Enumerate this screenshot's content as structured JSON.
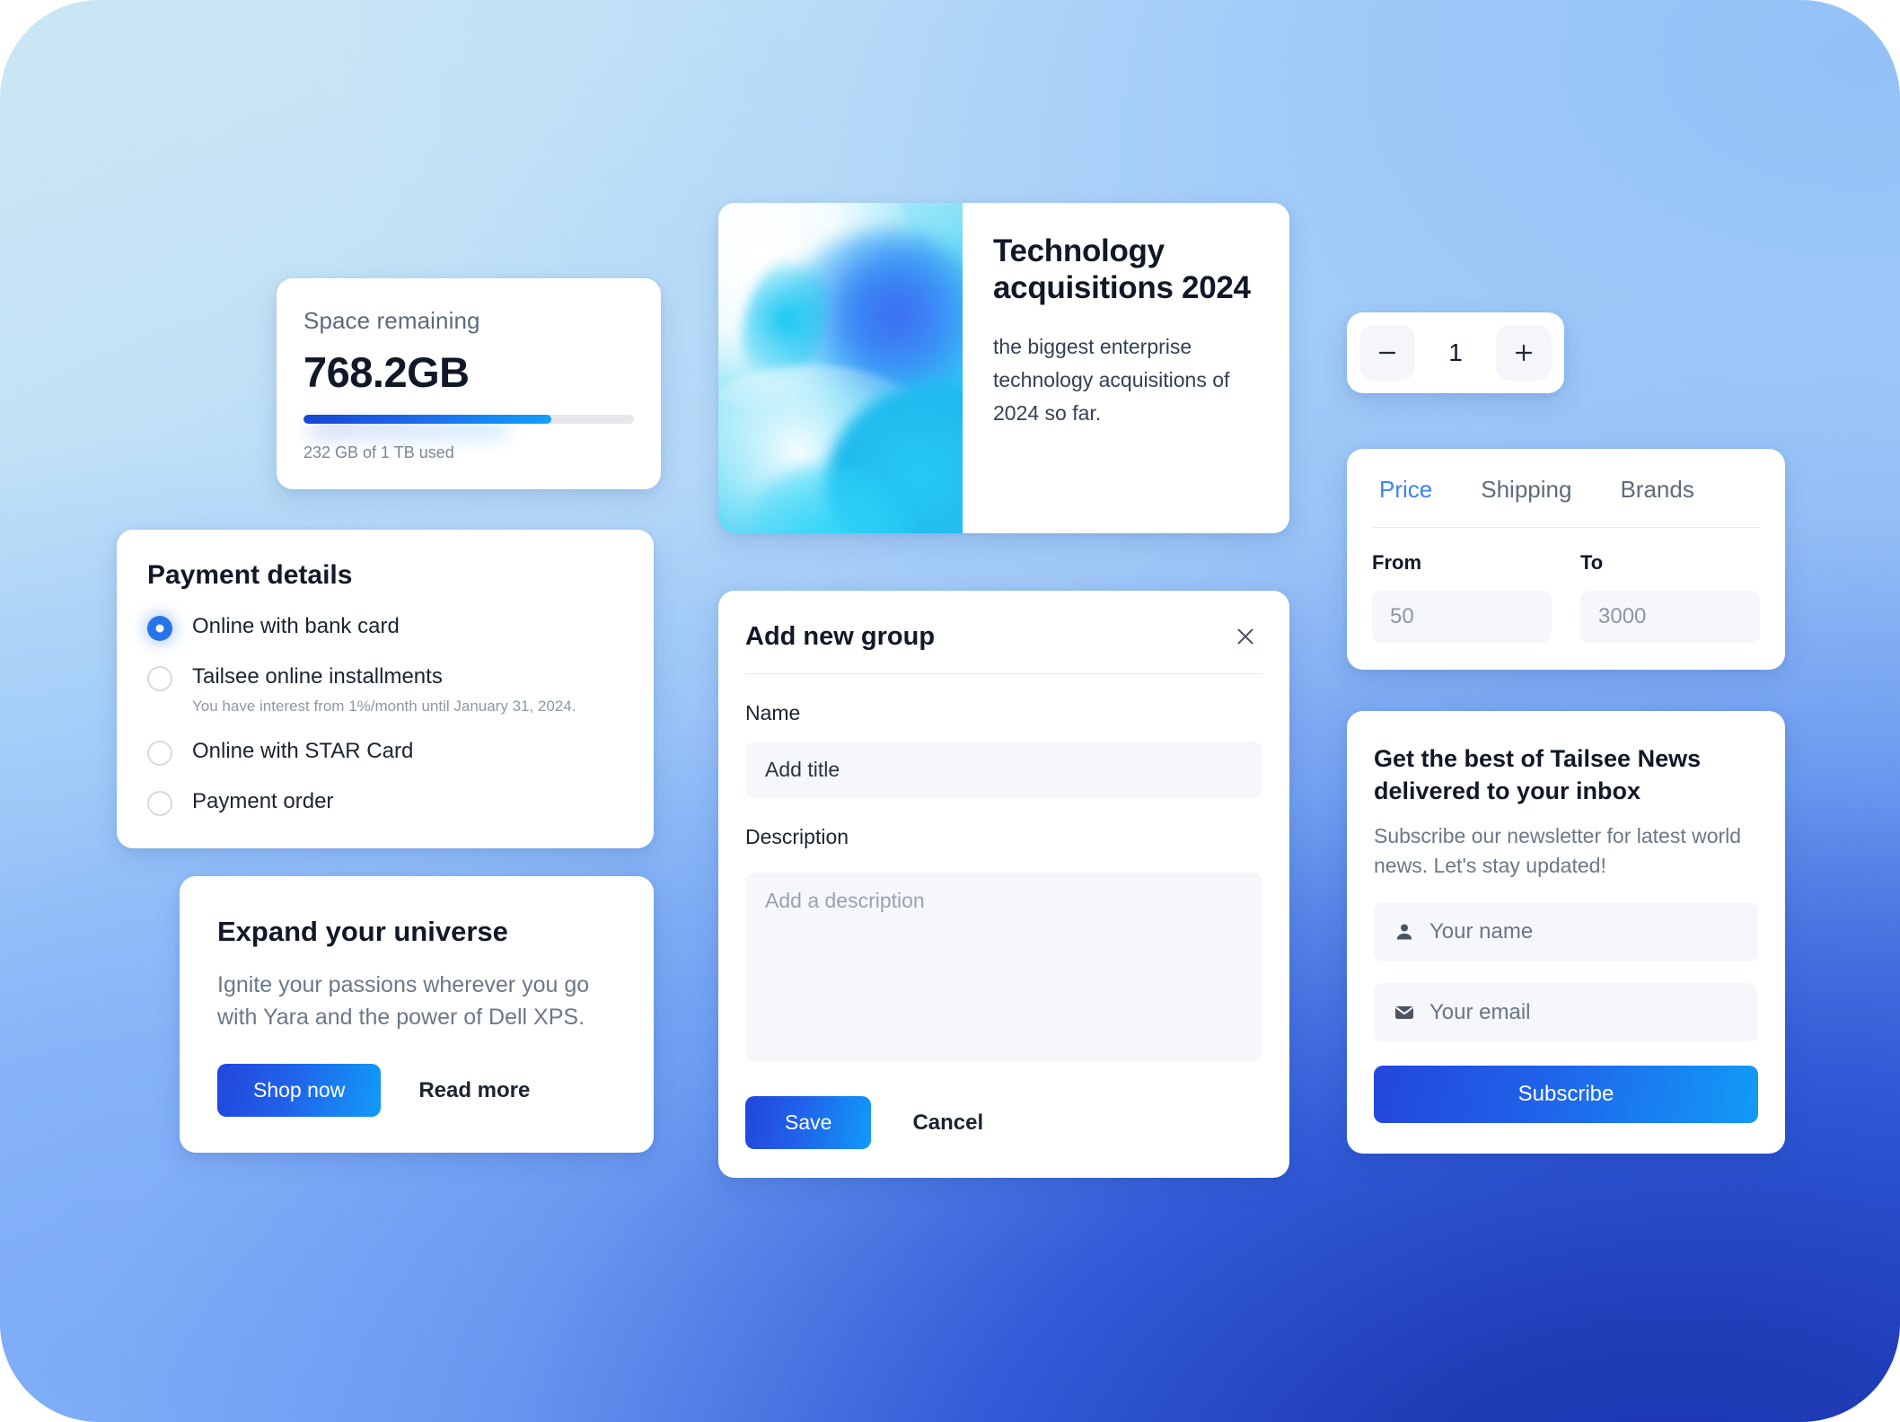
{
  "space": {
    "title": "Space remaining",
    "value": "768.2GB",
    "used_label": "232 GB of 1 TB used",
    "percent": 75
  },
  "payment": {
    "title": "Payment details",
    "options": [
      {
        "label": "Online with bank card",
        "selected": true,
        "note": ""
      },
      {
        "label": "Tailsee online installments",
        "selected": false,
        "note": "You have interest from 1%/month until January 31, 2024."
      },
      {
        "label": "Online with STAR Card",
        "selected": false,
        "note": ""
      },
      {
        "label": "Payment order",
        "selected": false,
        "note": ""
      }
    ]
  },
  "expand": {
    "title": "Expand your universe",
    "body": "Ignite your passions wherever you go with Yara and the power of Dell XPS.",
    "primary_label": "Shop now",
    "secondary_label": "Read more"
  },
  "tech": {
    "title": "Technology acquisitions 2024",
    "description": "the biggest enterprise technology acquisitions of 2024 so far.",
    "media_alt": "abstract-blue-swirl-image"
  },
  "group": {
    "title": "Add new group",
    "close_icon": "close-icon",
    "name_label": "Name",
    "name_placeholder": "Add title",
    "description_label": "Description",
    "description_placeholder": "Add a description",
    "save_label": "Save",
    "cancel_label": "Cancel"
  },
  "stepper": {
    "decrement_icon": "minus-icon",
    "increment_icon": "plus-icon",
    "value": "1"
  },
  "filter": {
    "tabs": [
      {
        "label": "Price",
        "active": true
      },
      {
        "label": "Shipping",
        "active": false
      },
      {
        "label": "Brands",
        "active": false
      }
    ],
    "from_label": "From",
    "from_placeholder": "50",
    "to_label": "To",
    "to_placeholder": "3000"
  },
  "newsletter": {
    "title": "Get the best of Tailsee News delivered to your inbox",
    "subtitle": "Subscribe our newsletter for latest world news. Let's stay updated!",
    "name_icon": "user-icon",
    "name_placeholder": "Your name",
    "email_icon": "envelope-icon",
    "email_placeholder": "Your email",
    "subscribe_label": "Subscribe"
  },
  "colors": {
    "accent_blue": "#2673eb",
    "link_blue": "#3b82f6",
    "gradient_start": "#2346dd",
    "gradient_end": "#119bf7",
    "bg_top_left": "#cbe6f5",
    "bg_bottom_right": "#1f3bb5"
  }
}
